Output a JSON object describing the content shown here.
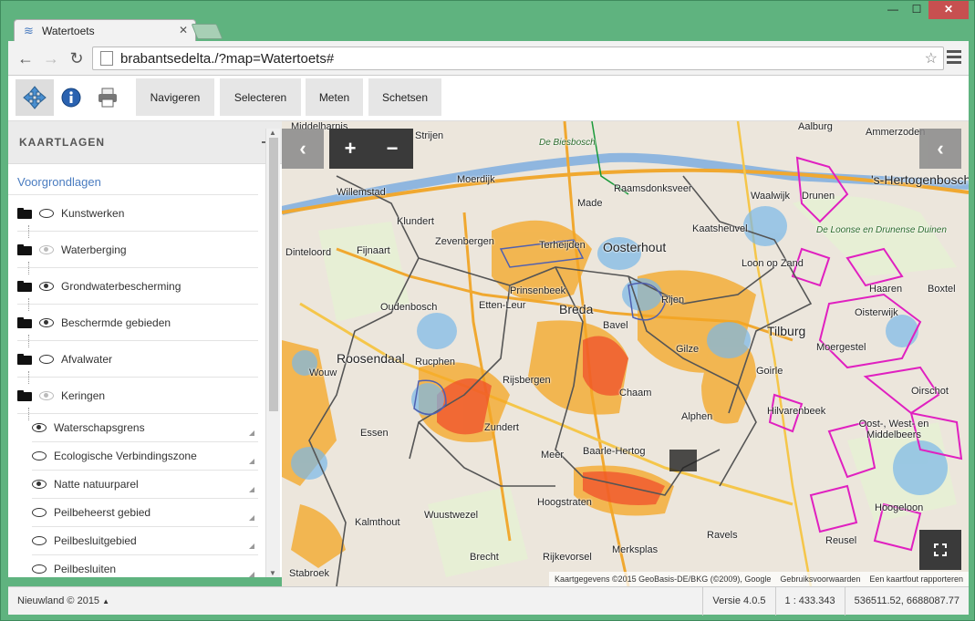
{
  "browser": {
    "tab_title": "Watertoets",
    "url": "brabantsedelta./?map=Watertoets#"
  },
  "toolbar": {
    "buttons": [
      "Navigeren",
      "Selecteren",
      "Meten",
      "Schetsen"
    ]
  },
  "panel": {
    "title": "KAARTLAGEN",
    "section": "Voorgrondlagen",
    "layers": [
      {
        "label": "Kunstwerken",
        "visible": "off"
      },
      {
        "label": "Waterberging",
        "visible": "dim"
      },
      {
        "label": "Grondwaterbescherming",
        "visible": "on"
      },
      {
        "label": "Beschermde gebieden",
        "visible": "on"
      },
      {
        "label": "Afvalwater",
        "visible": "off"
      },
      {
        "label": "Keringen",
        "visible": "dim"
      }
    ],
    "sublayers": [
      {
        "label": "Waterschapsgrens",
        "visible": "on"
      },
      {
        "label": "Ecologische Verbindingszone",
        "visible": "off"
      },
      {
        "label": "Natte natuurparel",
        "visible": "on"
      },
      {
        "label": "Peilbeheerst gebied",
        "visible": "off"
      },
      {
        "label": "Peilbesluitgebied",
        "visible": "off"
      },
      {
        "label": "Peilbesluiten",
        "visible": "off"
      }
    ]
  },
  "map": {
    "attribution": [
      "Kaartgegevens ©2015 GeoBasis-DE/BKG (©2009), Google",
      "Gebruiksvoorwaarden",
      "Een kaartfout rapporteren"
    ],
    "places": [
      "Aalburg",
      "Ammerzoden",
      "De Biesbosch",
      "Strijen",
      "Middelharnis",
      "'s-Hertogenbosch",
      "Willemstad",
      "Moerdijk",
      "Raamsdonksveer",
      "Waalwijk",
      "Drunen",
      "Made",
      "Klundert",
      "Zevenbergen",
      "Terheijden",
      "Oosterhout",
      "Kaatsheuvel",
      "De Loonse en Drunense Duinen",
      "Dinteloord",
      "Fijnaart",
      "Loon op Zand",
      "Oudenbosch",
      "Etten-Leur",
      "Prinsenbeek",
      "Breda",
      "Rijen",
      "Haaren",
      "Boxtel",
      "Roosendaal",
      "Rucphen",
      "Bavel",
      "Tilburg",
      "Oisterwijk",
      "Gilze",
      "Moergestel",
      "Wouw",
      "Rijsbergen",
      "Goirle",
      "Chaam",
      "Hilvarenbeek",
      "Oirschot",
      "Alphen",
      "Zundert",
      "Essen",
      "Oost-, West- en Middelbeers",
      "Meer",
      "Baarle-Hertog",
      "Hoogstraten",
      "Hoogeloon",
      "Kalmthout",
      "Wuustwezel",
      "Ravels",
      "Reusel",
      "Brecht",
      "Merksplas",
      "Rijkevorsel",
      "Stabroek"
    ]
  },
  "status": {
    "copyright": "Nieuwland © 2015",
    "version": "Versie 4.0.5",
    "scale": "1 : 433.343",
    "coords": "536511.52, 6688087.77"
  },
  "colors": {
    "accent": "#4a7cc0",
    "window_frame": "#5fb37f",
    "region_orange": "#f5a623",
    "region_magenta": "#e020c0",
    "region_blue": "#7ab8e8"
  }
}
